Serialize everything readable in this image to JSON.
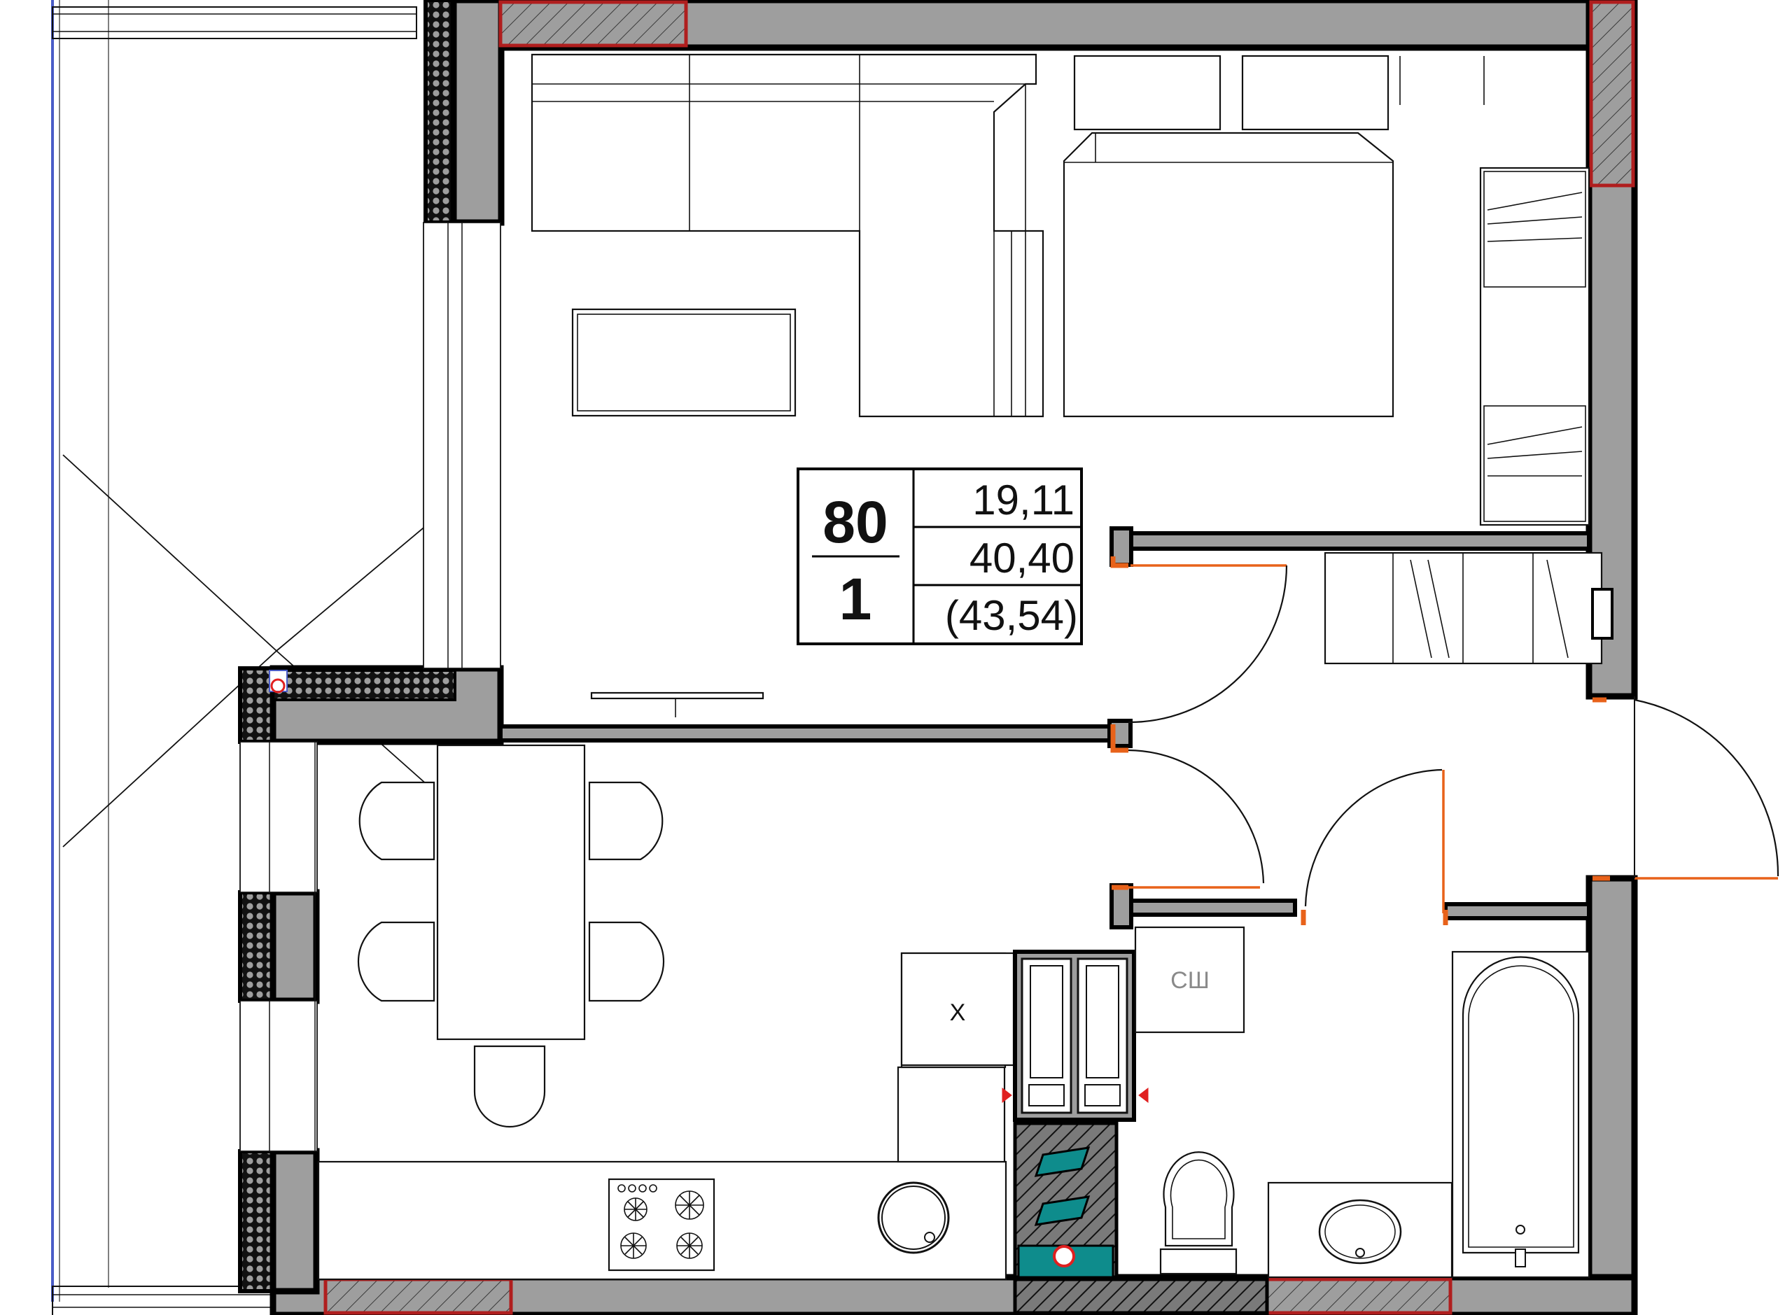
{
  "plan": {
    "apartment_label": {
      "number": "80",
      "rooms": "1",
      "living_area": "19,11",
      "total_area": "40,40",
      "total_area_with_balcony": "(43,54)"
    },
    "bathroom_tag": "СШ",
    "cooker_tag": "Х"
  },
  "colors": {
    "wall_fill": "#9e9e9e",
    "wall_outline": "#000000",
    "door_opening": "#e8621a",
    "section_outline": "#b01e1e",
    "service_shaft": "#0e8c8c",
    "window_line": "#4a5cc7"
  }
}
